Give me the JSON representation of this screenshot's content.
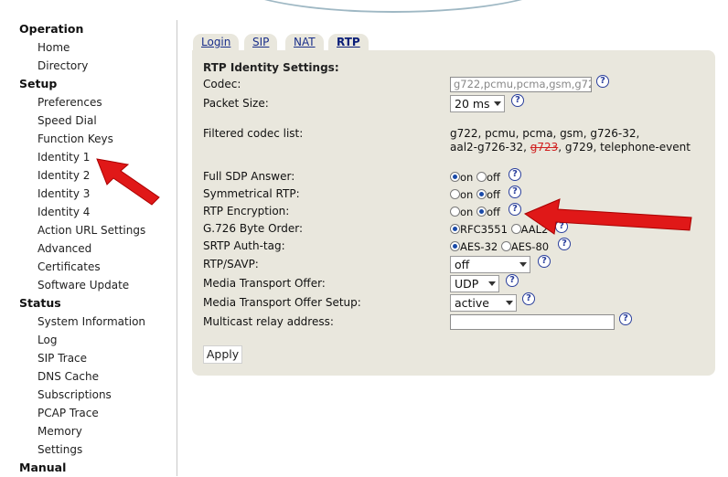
{
  "sidebar": {
    "sections": [
      {
        "title": "Operation",
        "items": [
          "Home",
          "Directory"
        ]
      },
      {
        "title": "Setup",
        "items": [
          "Preferences",
          "Speed Dial",
          "Function Keys",
          "Identity 1",
          "Identity 2",
          "Identity 3",
          "Identity 4",
          "Action URL Settings",
          "Advanced",
          "Certificates",
          "Software Update"
        ]
      },
      {
        "title": "Status",
        "items": [
          "System Information",
          "Log",
          "SIP Trace",
          "DNS Cache",
          "Subscriptions",
          "PCAP Trace",
          "Memory",
          "Settings"
        ]
      },
      {
        "title": "Manual",
        "items": []
      }
    ]
  },
  "tabs": [
    "Login",
    "SIP",
    "NAT",
    "RTP"
  ],
  "active_tab": "RTP",
  "panel": {
    "title": "RTP Identity Settings:",
    "codec_label": "Codec:",
    "codec_value": "g722,pcmu,pcma,gsm,g72",
    "packet_size_label": "Packet Size:",
    "packet_size_value": "20 ms",
    "filtered_label": "Filtered codec list:",
    "filtered_line1": "g722, pcmu, pcma, gsm, g726-32,",
    "filtered_line2_a": "aal2-g726-32, ",
    "filtered_line2_struck": "g723",
    "filtered_line2_b": ", g729, telephone-event",
    "full_sdp_label": "Full SDP Answer:",
    "sym_rtp_label": "Symmetrical RTP:",
    "rtp_enc_label": "RTP Encryption:",
    "g726_label": "G.726 Byte Order:",
    "srtp_label": "SRTP Auth-tag:",
    "rtp_savp_label": "RTP/SAVP:",
    "rtp_savp_value": "off",
    "mto_label": "Media Transport Offer:",
    "mto_value": "UDP",
    "mtos_label": "Media Transport Offer Setup:",
    "mtos_value": "active",
    "multicast_label": "Multicast relay address:",
    "opt_on": "on",
    "opt_off": "off",
    "opt_rfc": "RFC3551",
    "opt_aal2": "AAL2",
    "opt_aes32": "AES-32",
    "opt_aes80": "AES-80",
    "help_glyph": "?",
    "apply_label": "Apply"
  },
  "colors": {
    "panel_bg": "#e9e7dd",
    "link": "#1a2f8a",
    "annotation_arrow": "#e01818",
    "strike_text": "#d02020"
  }
}
